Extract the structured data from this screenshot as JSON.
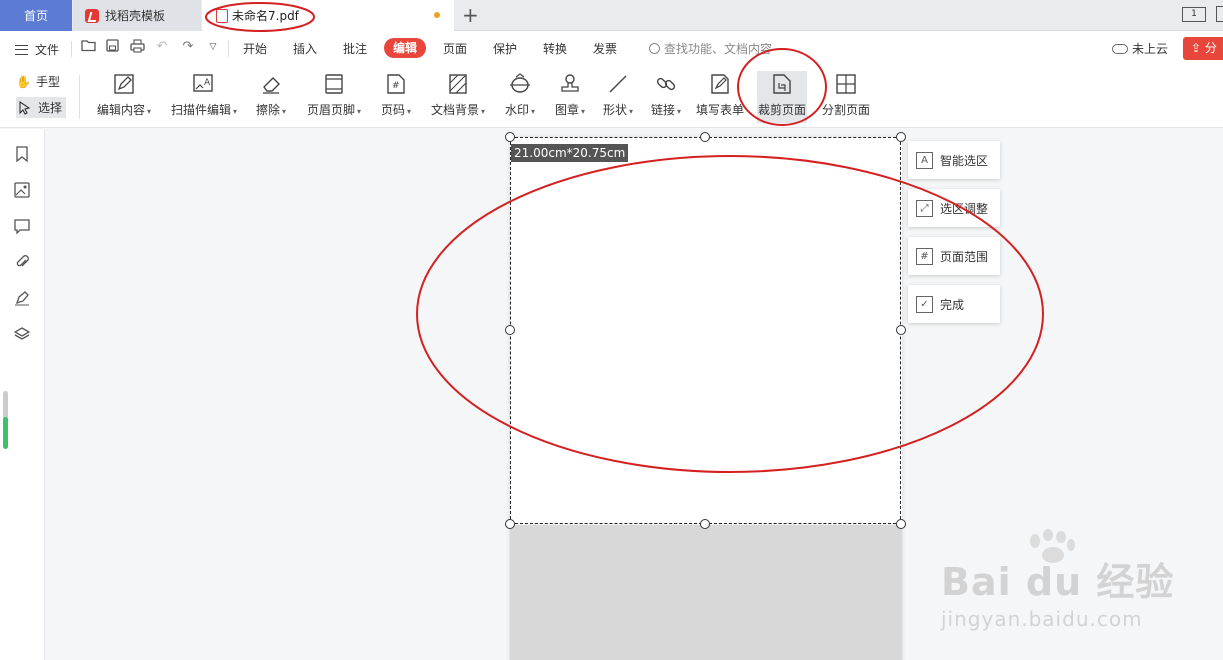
{
  "tabs": {
    "home": "首页",
    "daoke": "找稻壳模板",
    "active_file": "未命名7.pdf"
  },
  "window": {
    "page_view_label": "1"
  },
  "menu": {
    "file": "文件",
    "tabs": [
      "开始",
      "插入",
      "批注",
      "编辑",
      "页面",
      "保护",
      "转换",
      "发票"
    ],
    "active_tab": "编辑",
    "search_placeholder": "查找功能、文档内容",
    "cloud_status": "未上云",
    "share": "分"
  },
  "toolbar": {
    "hand": "手型",
    "select": "选择",
    "tools": [
      {
        "label": "编辑内容",
        "icon": "edit-content-icon",
        "caret": true
      },
      {
        "label": "扫描件编辑",
        "icon": "scan-edit-icon",
        "caret": true
      },
      {
        "label": "擦除",
        "icon": "eraser-icon",
        "caret": true
      },
      {
        "label": "页眉页脚",
        "icon": "header-footer-icon",
        "caret": true
      },
      {
        "label": "页码",
        "icon": "page-number-icon",
        "caret": true
      },
      {
        "label": "文档背景",
        "icon": "doc-background-icon",
        "caret": true
      },
      {
        "label": "水印",
        "icon": "watermark-icon",
        "caret": true
      },
      {
        "label": "图章",
        "icon": "stamp-icon",
        "caret": true
      },
      {
        "label": "形状",
        "icon": "shape-icon",
        "caret": true
      },
      {
        "label": "链接",
        "icon": "link-icon",
        "caret": true
      },
      {
        "label": "填写表单",
        "icon": "fill-form-icon",
        "caret": false
      },
      {
        "label": "裁剪页面",
        "icon": "crop-page-icon",
        "caret": false
      },
      {
        "label": "分割页面",
        "icon": "split-page-icon",
        "caret": false
      }
    ],
    "active_tool": "裁剪页面"
  },
  "crop": {
    "size_label": "21.00cm*20.75cm",
    "panel": [
      {
        "label": "智能选区",
        "icon": "smart-select-icon",
        "glyph": "A"
      },
      {
        "label": "选区调整",
        "icon": "adjust-select-icon",
        "glyph": "⤢"
      },
      {
        "label": "页面范围",
        "icon": "page-range-icon",
        "glyph": "#"
      },
      {
        "label": "完成",
        "icon": "done-icon",
        "glyph": "✓"
      }
    ]
  },
  "watermark": {
    "main": "Bai du 经验",
    "sub": "jingyan.baidu.com"
  },
  "colors": {
    "accent_red": "#e8463a",
    "home_tab_blue": "#5b7bd5",
    "annotation_red": "#d42020"
  }
}
